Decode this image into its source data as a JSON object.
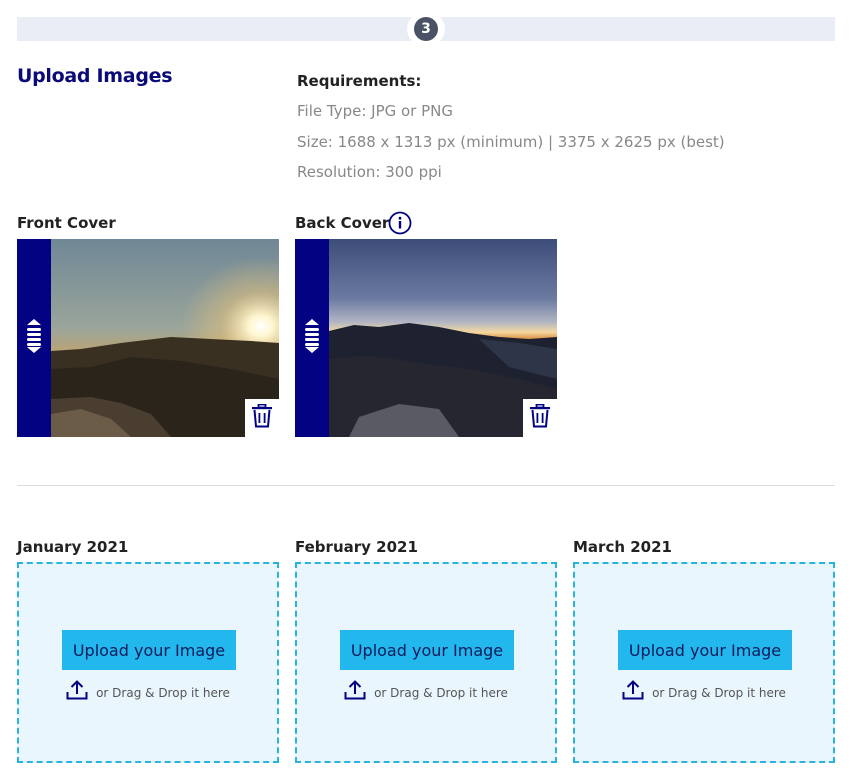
{
  "stepper": {
    "step_number": "3"
  },
  "section": {
    "title": "Upload Images"
  },
  "requirements": {
    "title": "Requirements:",
    "file_type": "File Type: JPG or PNG",
    "size": "Size: 1688 x 1313 px (minimum) | 3375 x 2625 px (best)",
    "resolution": "Resolution: 300 ppi"
  },
  "covers": [
    {
      "label": "Front Cover"
    },
    {
      "label": "Back Cover"
    }
  ],
  "months": [
    {
      "label": "January 2021",
      "button": "Upload your Image",
      "drag_text": "or Drag & Drop it here"
    },
    {
      "label": "February 2021",
      "button": "Upload your Image",
      "drag_text": "or Drag & Drop it here"
    },
    {
      "label": "March 2021",
      "button": "Upload your Image",
      "drag_text": "or Drag & Drop it here"
    }
  ],
  "colors": {
    "navy": "#020283",
    "upload_button": "#22b8ee",
    "dropzone_bg": "#eaf6fd",
    "dropzone_border": "#2bb3e0",
    "step_bar": "#e8edf6"
  },
  "icons": [
    "info-icon",
    "reorder-handle-icon",
    "trash-icon",
    "upload-icon"
  ]
}
